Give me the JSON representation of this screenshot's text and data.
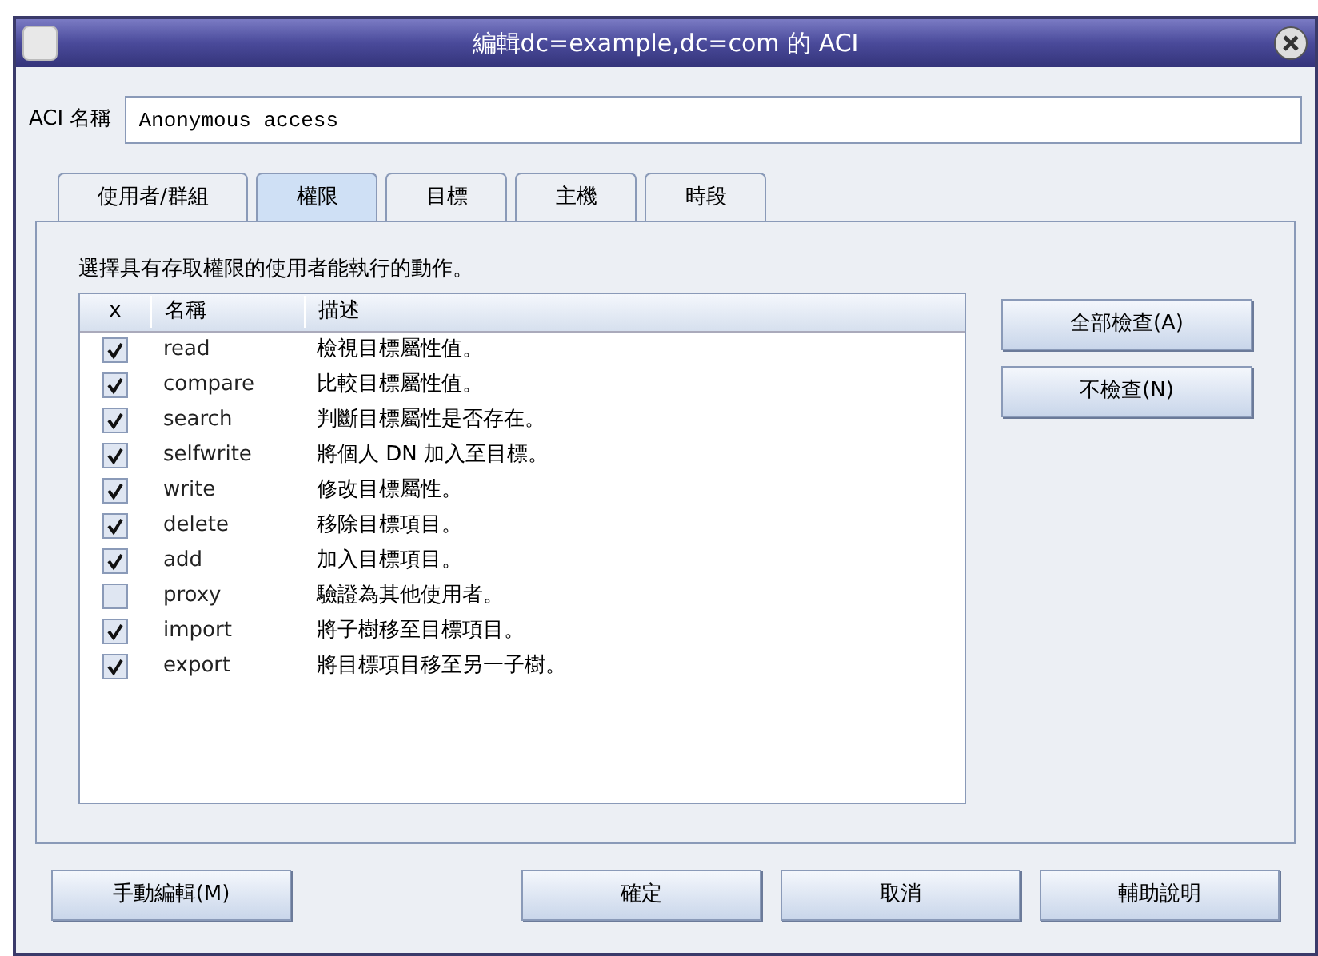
{
  "window": {
    "title": "編輯dc=example,dc=com 的 ACI"
  },
  "aci_name": {
    "label": "ACI 名稱",
    "value": "Anonymous access"
  },
  "tabs": [
    {
      "label": "使用者/群組",
      "selected": false
    },
    {
      "label": "權限",
      "selected": true
    },
    {
      "label": "目標",
      "selected": false
    },
    {
      "label": "主機",
      "selected": false
    },
    {
      "label": "時段",
      "selected": false
    }
  ],
  "instruction": "選擇具有存取權限的使用者能執行的動作。",
  "table": {
    "columns": [
      "x",
      "名稱",
      "描述"
    ],
    "rows": [
      {
        "name": "read",
        "description": "檢視目標屬性值。",
        "checked": true
      },
      {
        "name": "compare",
        "description": "比較目標屬性值。",
        "checked": true
      },
      {
        "name": "search",
        "description": "判斷目標屬性是否存在。",
        "checked": true
      },
      {
        "name": "selfwrite",
        "description": "將個人 DN 加入至目標。",
        "checked": true
      },
      {
        "name": "write",
        "description": "修改目標屬性。",
        "checked": true
      },
      {
        "name": "delete",
        "description": "移除目標項目。",
        "checked": true
      },
      {
        "name": "add",
        "description": "加入目標項目。",
        "checked": true
      },
      {
        "name": "proxy",
        "description": "驗證為其他使用者。",
        "checked": false
      },
      {
        "name": "import",
        "description": "將子樹移至目標項目。",
        "checked": true
      },
      {
        "name": "export",
        "description": "將目標項目移至另一子樹。",
        "checked": true
      }
    ]
  },
  "side_buttons": [
    "全部檢查(A)",
    "不檢查(N)"
  ],
  "footer_buttons": [
    {
      "label": "手動編輯(M)"
    },
    {
      "label": "確定"
    },
    {
      "label": "取消"
    },
    {
      "label": "輔助說明"
    }
  ]
}
